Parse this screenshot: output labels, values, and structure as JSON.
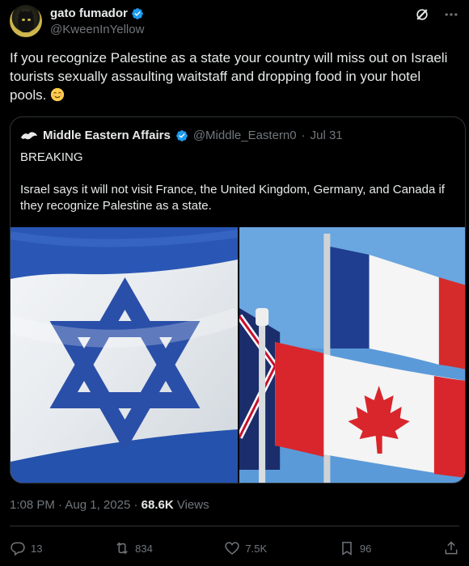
{
  "author": {
    "display_name": "gato fumador",
    "handle": "@KweenInYellow",
    "verified": true
  },
  "tweet": {
    "text": "If you recognize Palestine as a state your country will miss out on Israeli tourists sexually assaulting waitstaff and dropping food in your hotel pools.",
    "emoji": "relieved-face"
  },
  "quoted_tweet": {
    "display_name": "Middle Eastern Affairs",
    "handle": "@Middle_Eastern0",
    "separator": "·",
    "date": "Jul 31",
    "verified": true,
    "line1": "BREAKING",
    "line2": "Israel says it will not visit France, the United Kingdom, Germany, and Canada if they recognize Palestine as a state.",
    "media": [
      "israel-flag-image",
      "france-canada-uk-flags-image"
    ]
  },
  "meta": {
    "time": "1:08 PM",
    "sep": "·",
    "date": "Aug 1, 2025",
    "sep2": "·",
    "views_count": "68.6K",
    "views_label": "Views"
  },
  "actions": {
    "replies": "13",
    "reposts": "834",
    "likes": "7.5K",
    "bookmarks": "96"
  },
  "colors": {
    "background": "#000000",
    "text": "#e7e9ea",
    "muted": "#71767b",
    "border": "#2f3336",
    "verified_blue": "#1d9bf0"
  }
}
